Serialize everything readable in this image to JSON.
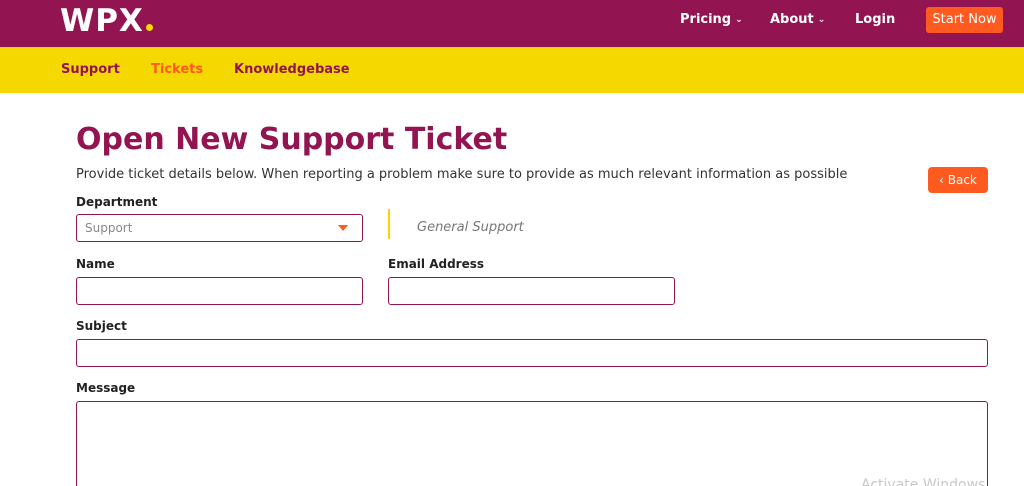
{
  "header": {
    "logo_text": "WPX",
    "nav": [
      {
        "label": "Pricing"
      },
      {
        "label": "About"
      },
      {
        "label": "Login"
      }
    ],
    "cta_label": "Start Now"
  },
  "subnav": {
    "items": [
      {
        "label": "Support"
      },
      {
        "label": "Tickets"
      },
      {
        "label": "Knowledgebase"
      }
    ],
    "active": "Tickets"
  },
  "page": {
    "title": "Open New Support Ticket",
    "intro": "Provide ticket details below. When reporting a problem make sure to provide as much relevant information as possible",
    "back_label": "Back"
  },
  "form": {
    "department_label": "Department",
    "department_value": "Support",
    "department_description": "General Support",
    "name_label": "Name",
    "name_value": "",
    "email_label": "Email Address",
    "email_value": "",
    "subject_label": "Subject",
    "subject_value": "",
    "message_label": "Message",
    "message_value": ""
  },
  "overlay": {
    "watermark": "Activate Windows"
  },
  "colors": {
    "brand_purple": "#921551",
    "brand_yellow": "#f5d800",
    "accent_orange": "#ff5a1f"
  }
}
